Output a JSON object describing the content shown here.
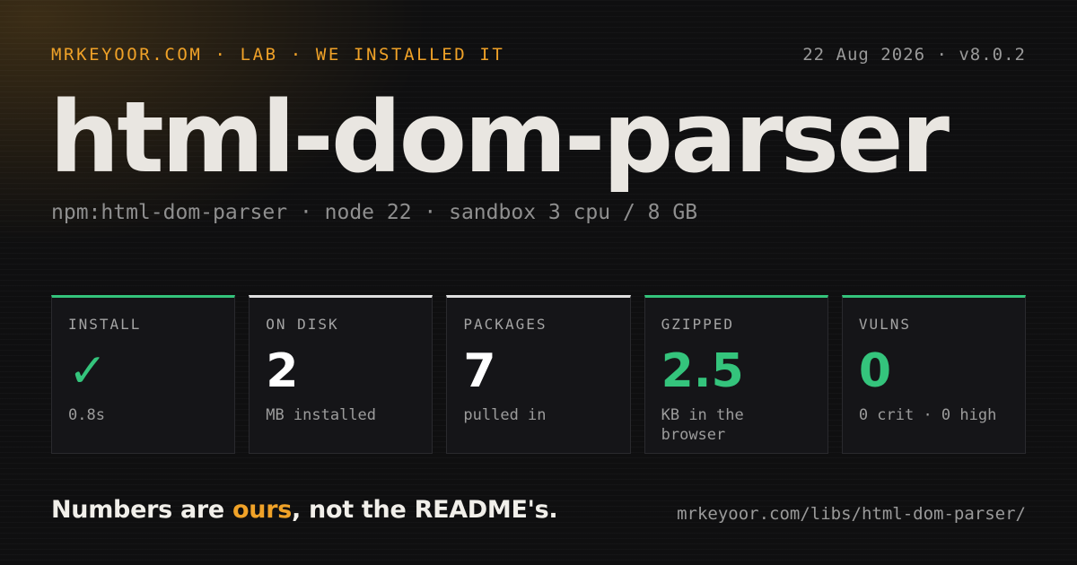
{
  "header": {
    "kicker": "MRKEYOOR.COM · LAB · WE INSTALLED IT",
    "meta": "22 Aug 2026 · v8.0.2"
  },
  "title": "html-dom-parser",
  "subtitle": "npm:html-dom-parser · node 22 · sandbox 3 cpu / 8 GB",
  "stats": [
    {
      "label": "INSTALL",
      "value": "✓",
      "note": "0.8s",
      "accent": "#34c47c"
    },
    {
      "label": "ON DISK",
      "value": "2",
      "note": "MB installed",
      "accent": "#e0e0e0"
    },
    {
      "label": "PACKAGES",
      "value": "7",
      "note": "pulled in",
      "accent": "#e0e0e0"
    },
    {
      "label": "GZIPPED",
      "value": "2.5",
      "note": "KB in the browser",
      "accent": "#34c47c"
    },
    {
      "label": "VULNS",
      "value": "0",
      "note": "0 crit · 0 high",
      "accent": "#34c47c"
    }
  ],
  "footer": {
    "tagline_pre": "Numbers are ",
    "tagline_highlight": "ours",
    "tagline_post": ", not the README's.",
    "url": "mrkeyoor.com/libs/html-dom-parser/"
  },
  "colors": {
    "accent_orange": "#f0a228",
    "accent_green": "#34c47c",
    "background": "#0f0f10"
  }
}
